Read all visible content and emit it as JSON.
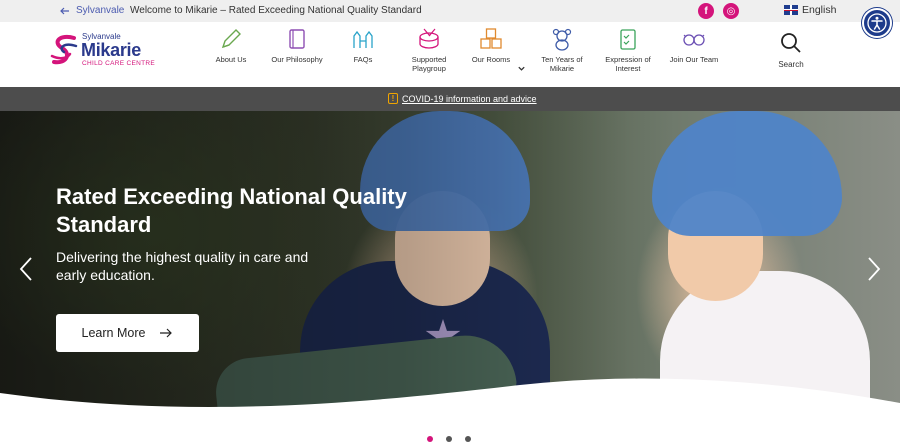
{
  "topbar": {
    "back_label": "Sylvanvale",
    "welcome": "Welcome to Mikarie – Rated Exceeding National Quality Standard",
    "social": [
      {
        "icon": "facebook-icon",
        "glyph": "f"
      },
      {
        "icon": "instagram-icon",
        "glyph": "◎"
      }
    ],
    "language": "English"
  },
  "logo": {
    "line1": "Sylvanvale",
    "line2": "Mikarie",
    "line3": "CHILD CARE CENTRE"
  },
  "nav": [
    {
      "label": "About Us",
      "icon": "pencil-icon"
    },
    {
      "label": "Our Philosophy",
      "icon": "book-icon"
    },
    {
      "label": "FAQs",
      "icon": "castle-icon"
    },
    {
      "label": "Supported Playgroup",
      "icon": "drum-icon"
    },
    {
      "label": "Our Rooms",
      "icon": "blocks-icon"
    },
    {
      "label": "Ten Years of Mikarie",
      "icon": "teddy-bear-icon"
    },
    {
      "label": "Expression of Interest",
      "icon": "checklist-icon"
    },
    {
      "label": "Join Our Team",
      "icon": "glasses-icon"
    }
  ],
  "search_label": "Search",
  "notice": {
    "icon": "!",
    "text": "COVID-19 information and advice"
  },
  "hero": {
    "title": "Rated Exceeding National Quality Standard",
    "subtitle": "Delivering the highest quality in care and early education.",
    "cta": "Learn More"
  },
  "carousel": {
    "slides": 3,
    "active": 0
  },
  "colors": {
    "brand_pink": "#d4147b",
    "brand_blue": "#2b3a8c",
    "notice_bg": "#4d4d4d"
  }
}
